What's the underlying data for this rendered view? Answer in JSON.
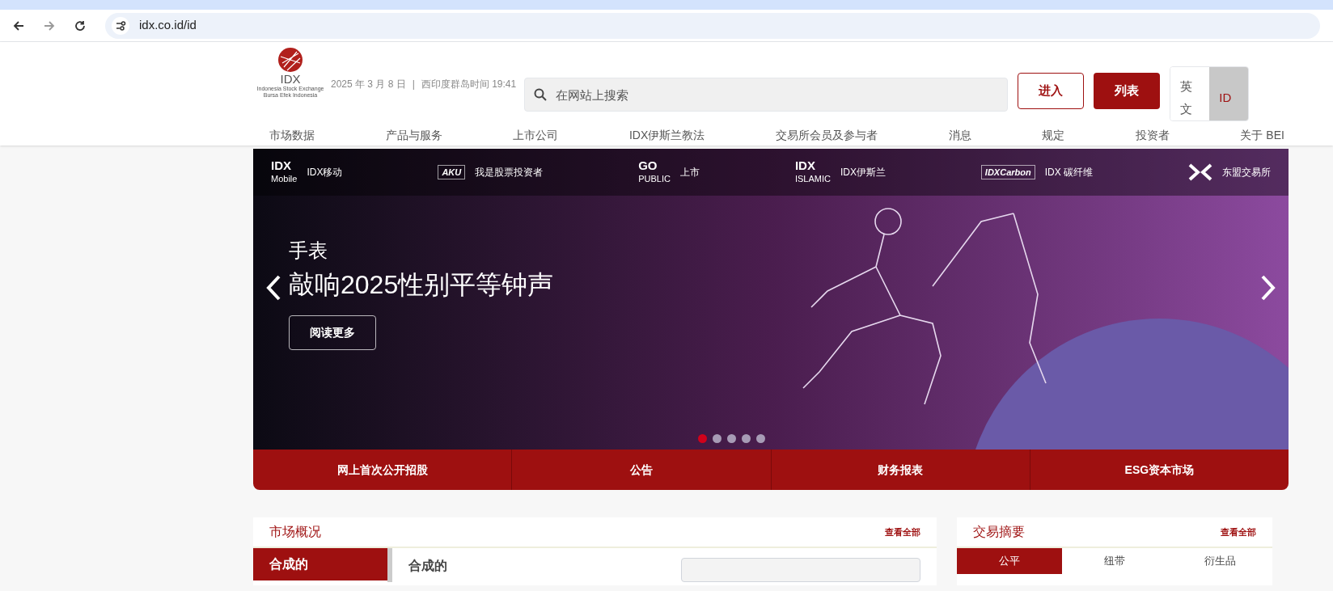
{
  "browser": {
    "url": "idx.co.id/id"
  },
  "header": {
    "logo_text": "IDX",
    "logo_subtitle": "Indonesia Stock Exchange",
    "logo_subtitle_2": "Bursa Efek Indonesia",
    "date": "2025 年 3 月 8 日",
    "separator": "|",
    "time": "西印度群岛时间 19:41",
    "search": {
      "placeholder": "在网站上搜索"
    },
    "login_button": "进入",
    "register_button": "列表",
    "languages": [
      {
        "label": "英文",
        "selected": false
      },
      {
        "label": "ID",
        "selected": true
      }
    ]
  },
  "nav": [
    "市场数据",
    "产品与服务",
    "上市公司",
    "IDX伊斯兰教法",
    "交易所会员及参与者",
    "消息",
    "规定",
    "投资者",
    "关于 BEI"
  ],
  "quick_links": [
    {
      "kind": "mobile",
      "logo": "IDX",
      "logo_2": "Mobile",
      "label": "IDX移动"
    },
    {
      "kind": "aku",
      "logo": "AKU",
      "label": "我是股票投资者"
    },
    {
      "kind": "go",
      "logo": "GO",
      "logo_2": "PUBLIC",
      "label": "上市"
    },
    {
      "kind": "islamic",
      "logo": "IDX",
      "logo_2": "ISLAMIC",
      "label": "IDX伊斯兰"
    },
    {
      "kind": "carbon",
      "logo": "IDXCarbon",
      "label": "IDX 碳纤维"
    },
    {
      "kind": "asean",
      "label": "东盟交易所"
    }
  ],
  "banner": {
    "subtitle": "手表",
    "title": "敲响2025性别平等钟声",
    "button": "阅读更多",
    "dots": [
      {
        "selected": true
      },
      {
        "selected": false
      },
      {
        "selected": false
      },
      {
        "selected": false
      },
      {
        "selected": false
      }
    ]
  },
  "banner_tabs": [
    "网上首次公开招股",
    "公告",
    "财务报表",
    "ESG资本市场"
  ],
  "market_overview": {
    "title": "市场概况",
    "view_all": "查看全部",
    "side_items": [
      {
        "label": "合成的",
        "selected": true
      }
    ],
    "heading": "合成的"
  },
  "trading_summary": {
    "title": "交易摘要",
    "view_all": "查看全部",
    "tabs": [
      {
        "label": "公平",
        "selected": true
      },
      {
        "label": "纽带",
        "selected": false
      },
      {
        "label": "衍生品",
        "selected": false
      }
    ]
  }
}
